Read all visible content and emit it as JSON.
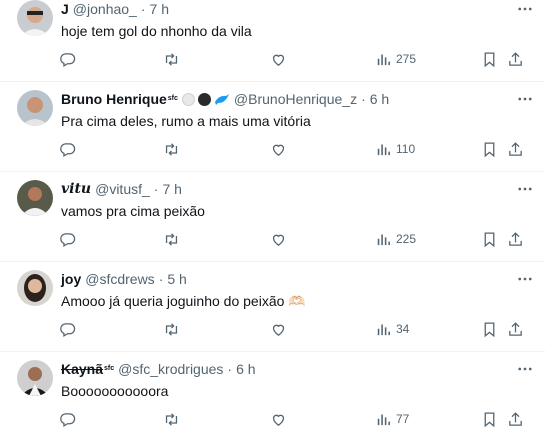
{
  "tweets": [
    {
      "name": "J",
      "handle": "@jonhao_",
      "time": "7 h",
      "text": "hoje tem gol do nhonho da vila",
      "views": "275"
    },
    {
      "name": "Bruno Henrique",
      "name_sup": "sfc",
      "handle": "@BrunoHenrique_z",
      "time": "6 h",
      "text": "Pra cima deles, rumo a mais uma vitória",
      "views": "110"
    },
    {
      "name": "vitu",
      "handle": "@vitusf_",
      "time": "7 h",
      "text": "vamos pra cima peixão",
      "views": "225"
    },
    {
      "name": "joy",
      "handle": "@sfcdrews",
      "time": "5 h",
      "text": "Amooo já queria joguinho do peixão 🫶🏻",
      "views": "34"
    },
    {
      "name": "Kaynã",
      "name_sup": "sfc",
      "handle": "@sfc_krodrigues",
      "time": "6 h",
      "text": "Booooooooooora",
      "views": "77"
    }
  ],
  "separator": "·",
  "colors": {
    "text_primary": "#0f1419",
    "text_secondary": "#536471",
    "divider": "#eff3f4",
    "dolphin_blue": "#1d9bf0"
  },
  "icons": [
    "more-icon",
    "reply-icon",
    "retweet-icon",
    "like-icon",
    "views-icon",
    "bookmark-icon",
    "share-icon"
  ]
}
